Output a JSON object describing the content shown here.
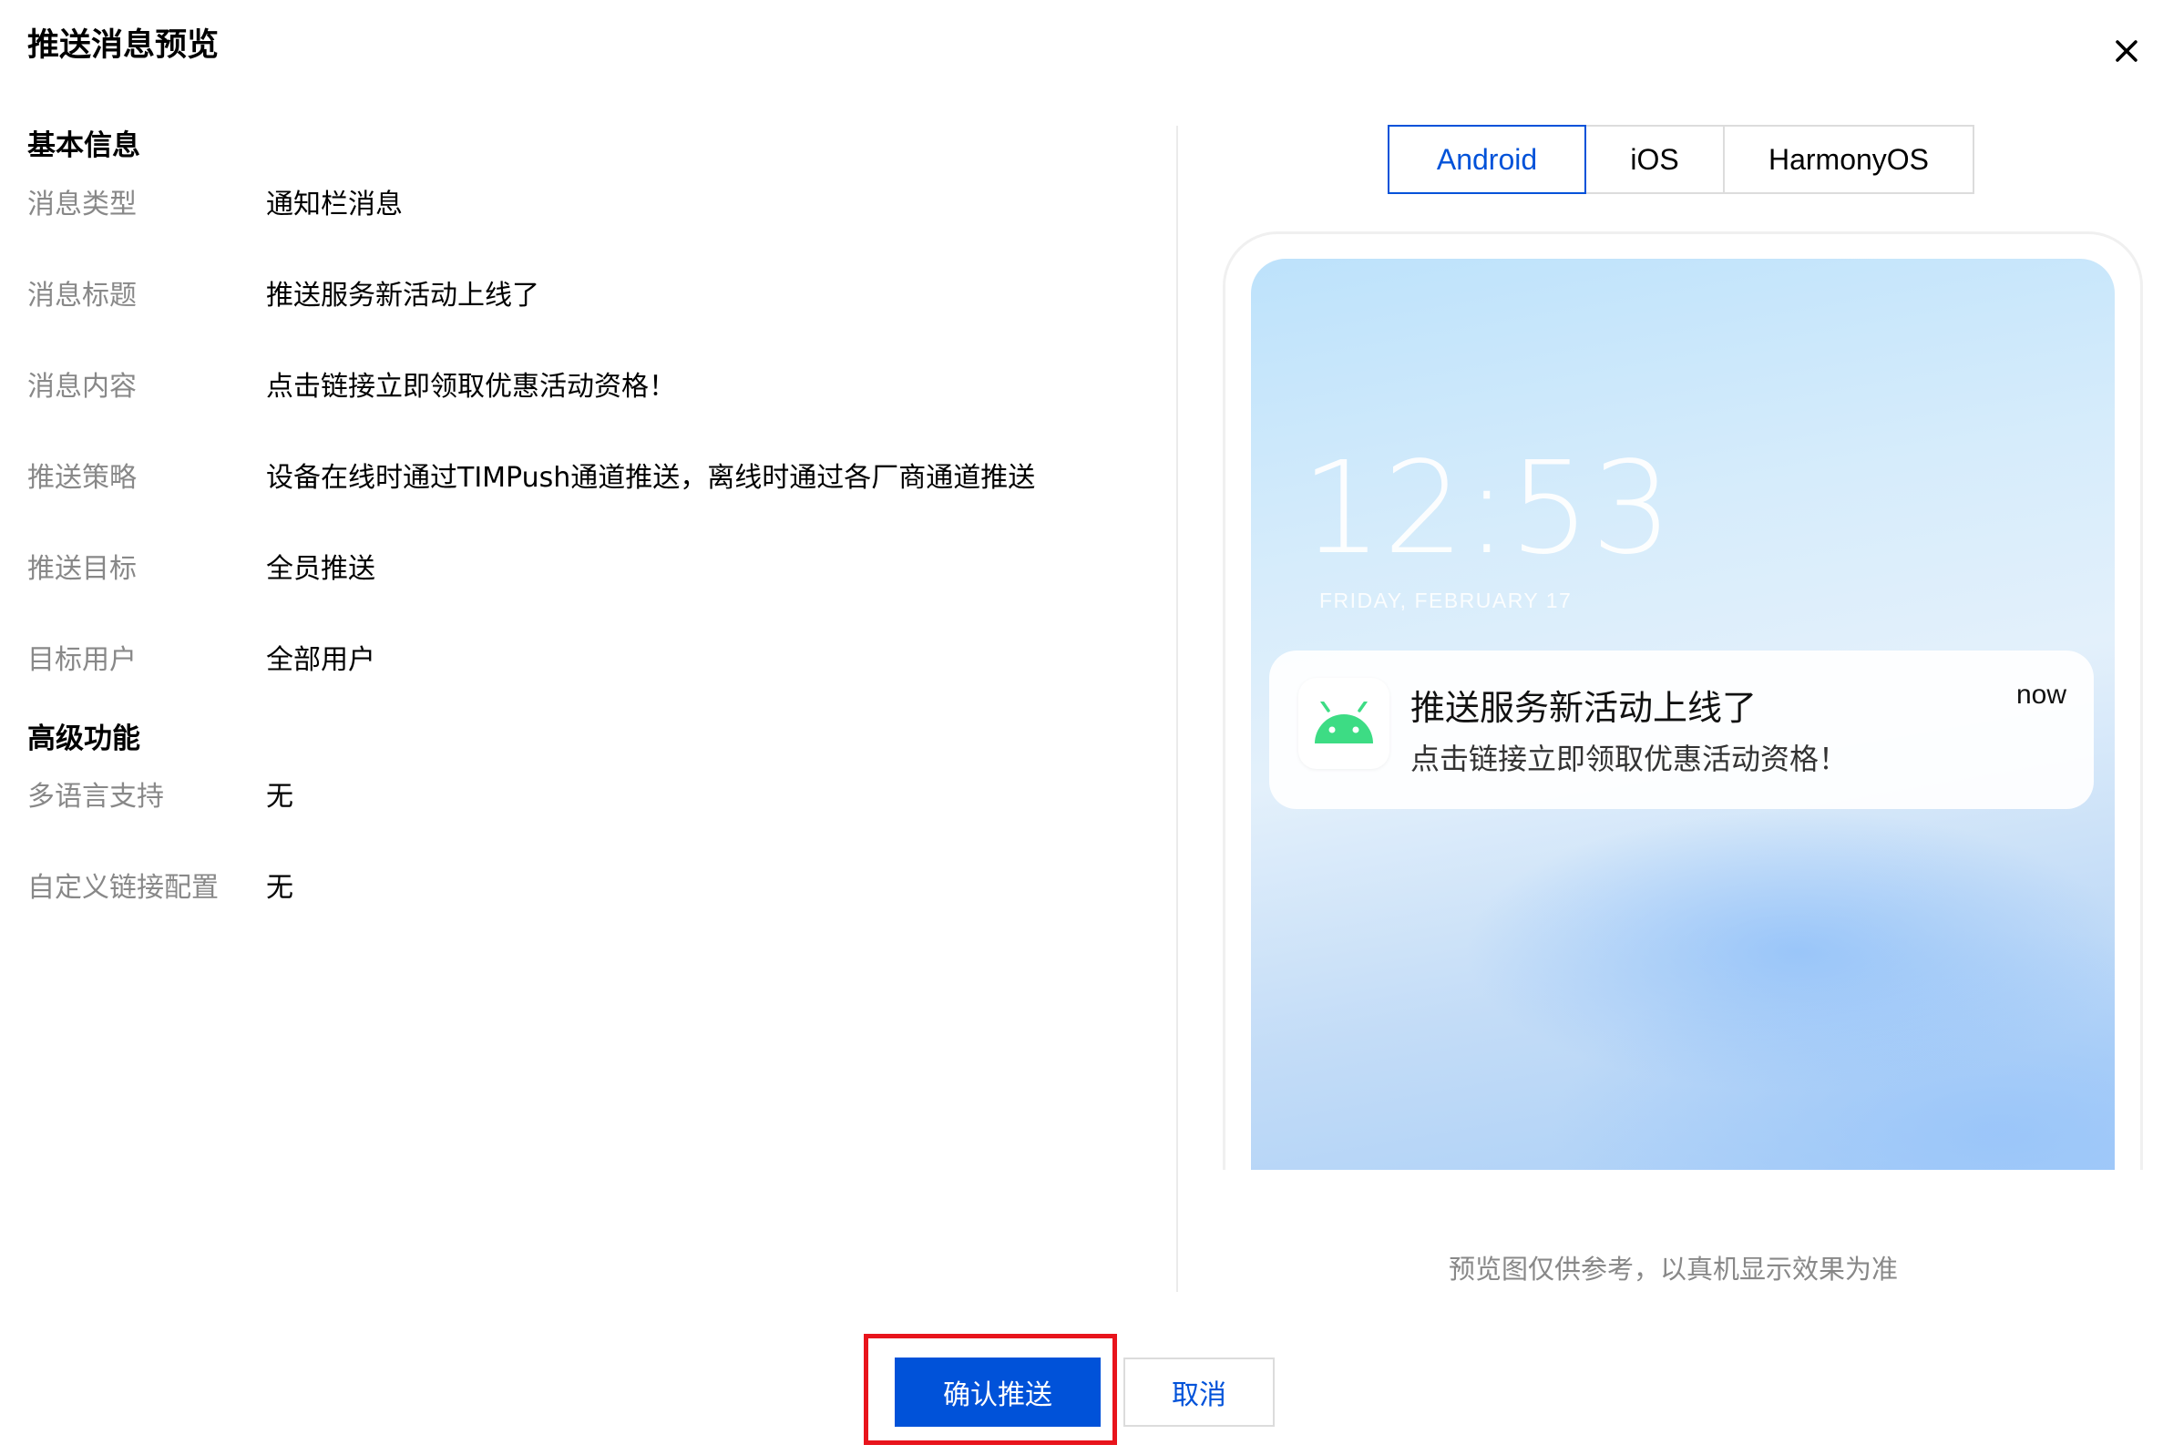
{
  "dialog": {
    "title": "推送消息预览"
  },
  "basic_info": {
    "section_title": "基本信息",
    "rows": [
      {
        "label": "消息类型",
        "value": "通知栏消息"
      },
      {
        "label": "消息标题",
        "value": "推送服务新活动上线了"
      },
      {
        "label": "消息内容",
        "value": "点击链接立即领取优惠活动资格！"
      },
      {
        "label": "推送策略",
        "value": "设备在线时通过TIMPush通道推送，离线时通过各厂商通道推送"
      },
      {
        "label": "推送目标",
        "value": "全员推送"
      },
      {
        "label": "目标用户",
        "value": "全部用户"
      }
    ]
  },
  "advanced": {
    "section_title": "高级功能",
    "rows": [
      {
        "label": "多语言支持",
        "value": "无"
      },
      {
        "label": "自定义链接配置",
        "value": "无"
      }
    ]
  },
  "preview": {
    "tabs": [
      {
        "label": "Android",
        "active": true
      },
      {
        "label": "iOS",
        "active": false
      },
      {
        "label": "HarmonyOS",
        "active": false
      }
    ],
    "lock_time": "12:53",
    "lock_date": "FRIDAY, FEBRUARY 17",
    "notification": {
      "icon": "android-icon",
      "title": "推送服务新活动上线了",
      "body": "点击链接立即领取优惠活动资格！",
      "time": "now"
    },
    "note": "预览图仅供参考，以真机显示效果为准"
  },
  "footer": {
    "confirm_label": "确认推送",
    "cancel_label": "取消"
  },
  "colors": {
    "primary": "#0052d9",
    "highlight_border": "#e8141c",
    "android_green": "#3ddc84"
  }
}
